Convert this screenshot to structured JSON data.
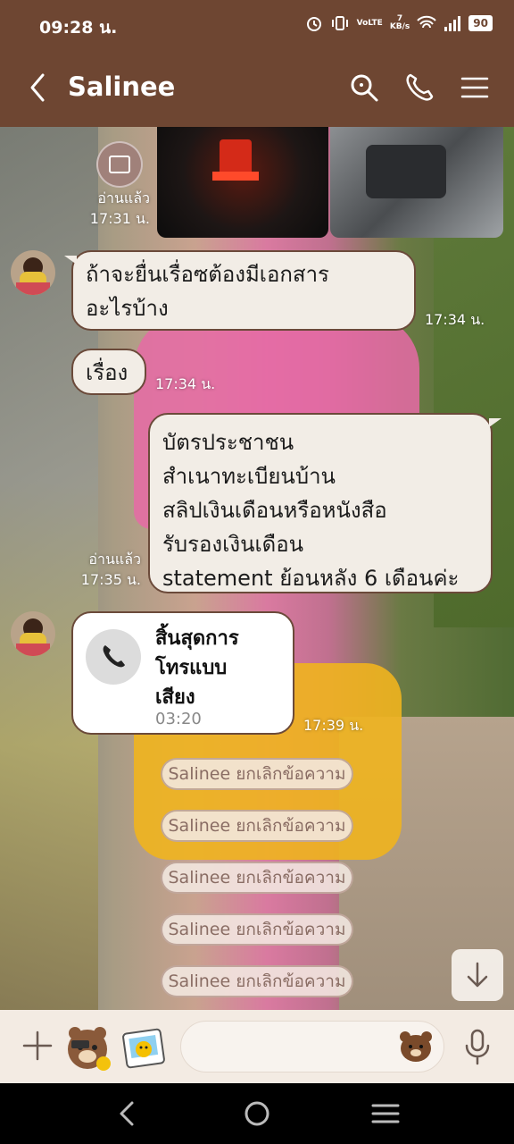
{
  "status_bar": {
    "time": "09:28 น.",
    "network_speed_value": "7",
    "network_speed_unit": "KB/s",
    "volte": "VoLTE",
    "battery": "90"
  },
  "header": {
    "contact_name": "Salinee"
  },
  "messages": {
    "read_1": {
      "status": "อ่านแล้ว",
      "time": "17:31 น."
    },
    "incoming_1": {
      "lines": [
        "ถ้าจะยื่นเรื่อซต้องมีเอกสาร",
        "อะไรบ้าง"
      ],
      "time": "17:34 น."
    },
    "incoming_2": {
      "text": "เรื่อง",
      "time": "17:34 น."
    },
    "outgoing_1": {
      "lines": [
        "บัตรประชาชน",
        "สำเนาทะเบียนบ้าน",
        "สลิปเงินเดือนหรือหนังสือ",
        "รับรองเงินเดือน",
        "statement ย้อนหลัง 6 เดือนค่ะ"
      ],
      "status": "อ่านแล้ว",
      "time": "17:35 น."
    },
    "call": {
      "lines": [
        "สิ้นสุดการ",
        "โทรแบบ",
        "เสียง"
      ],
      "duration": "03:20",
      "time": "17:39 น."
    },
    "unsent": [
      "Salinee ยกเลิกข้อความ",
      "Salinee ยกเลิกข้อความ",
      "Salinee ยกเลิกข้อความ",
      "Salinee ยกเลิกข้อความ",
      "Salinee ยกเลิกข้อความ"
    ]
  },
  "colors": {
    "header_bg": "#6e4632",
    "bubble_bg": "#f2ede6",
    "bubble_border": "#6b4a3a",
    "input_bar_bg": "#f3ebe3"
  },
  "icons": [
    "back-icon",
    "search-icon",
    "phone-icon",
    "menu-icon",
    "plus-icon",
    "sticker-icon",
    "emoji-icon",
    "mic-icon",
    "scroll-down-icon"
  ]
}
